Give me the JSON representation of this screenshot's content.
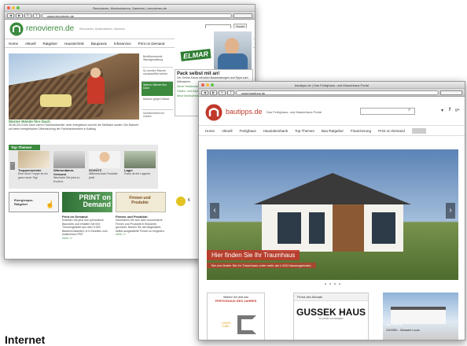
{
  "caption": "Internet",
  "colors": {
    "rv_green": "#3b8a3e",
    "bt_red": "#c0392b"
  },
  "rv": {
    "window_title": "Renovieren, Modernisieren, Sanieren | renovieren.de",
    "url": "www.renovieren.de",
    "logo": "renovieren.de",
    "tagline": "Renovieren, Modernisieren, Sanieren",
    "search_button": "Suche",
    "nav": [
      "Home",
      "Aktuell",
      "Ratgeber",
      "Haustechnik",
      "Baupraxis",
      "Infoservice",
      "Print on Demand"
    ],
    "hero_caption": "Warme Wände fürs Dach",
    "hero_text": "08.08.2013 Den Dach zieren Fachhandwerker unter energetisch und bei die Steildach saniert. Der Bauherr auf seine energetischen Überwachung der Fachhandwerkern in Auftrag.",
    "side_items": [
      "Breitflammende Wandgestaltung",
      "So werden Räume schadstofffrei sehen",
      "Warme Wände fürs Dach",
      "Mauern gegen Nässe",
      "Schwimmteich im Garten"
    ],
    "elmar_badge": "ELMAR",
    "pack_title": "Pack selbst mit an!",
    "pack_text": "Der Online-Kanal mit tollen Bauberatungen und Tipps zum Mitmachen.",
    "pack_links": [
      "Neuer Heizkessel",
      "Garten- und Garagenanlage",
      "Neue Mulbodenbelag",
      "Rollladen-Einbau",
      "Dachdämmung"
    ],
    "top_themen": "Top Themen",
    "top_items": [
      {
        "title": "Treppenmeister",
        "text": "Eine neue Treppe ist ein ganz neuer Tag!"
      },
      {
        "title": "Wärmedämm-Verbund",
        "text": "Wechseln Sie jetzt zu Evolent."
      },
      {
        "title": "SCHÜTZ",
        "text": "Wärmeschutz-Produkte jetzt!"
      },
      {
        "title": "Lager",
        "text": "Frank ist der Lagerist"
      }
    ],
    "promo_left": "Energiespar-Ratgeber",
    "promo_pod": "PRINT on Demand",
    "promo_pod_title": "Print on Demand:",
    "promo_pod_text": "Erstellen Sie jetzt Ihre persönliche Baurubrik und erhalten Sie Ihre Themengebiete aus über 9.000 Bauberichtsseiten; in 6 Schritten zum kostenlosen PDF.",
    "promo_firm": "Firmen und Produkte",
    "promo_firm_title": "Firmen und Produkte:",
    "promo_firm_text": "Informieren Sie sich über renommierte Firmen und Produkte in Branchen geordnet. Nutzen Sie die Möglichkeit, selbst ausgewählte Firmen zu eingeben.",
    "mehr": "mehr >>"
  },
  "bt": {
    "window_title": "bautipps.de | Das Fertighaus- und Massivhaus Portal",
    "url": "www.bautipps.de",
    "logo": "bautipps.de",
    "tagline": "Das Fertighaus- und Massivhaus Portal",
    "nav": [
      "Home",
      "Aktuell",
      "Fertighaus",
      "Hausideenbank",
      "Top Themen",
      "Bau-Ratgeber",
      "Finanzierung",
      "Print on Demand"
    ],
    "hero_caption": "Hier finden Sie Ihr Traumhaus",
    "hero_subcaption": "Bei uns finden Sie Ihr Traumhaus unter mehr als 1.000 Hausangeboten.",
    "cards": [
      {
        "header": "",
        "brand": "FERTIGHAUS DES JAHRES",
        "brand_top": "Wählen Sie jetzt das",
        "label": "LEBER CUBE"
      },
      {
        "header": "Firma des Monats",
        "brand": "GUSSEK HAUS",
        "sub": "SCHÖNE HAUSIDEEN"
      },
      {
        "header": "",
        "tag": "Top Thema",
        "label": "GUSSEK - Gebauter Luxus"
      }
    ]
  }
}
